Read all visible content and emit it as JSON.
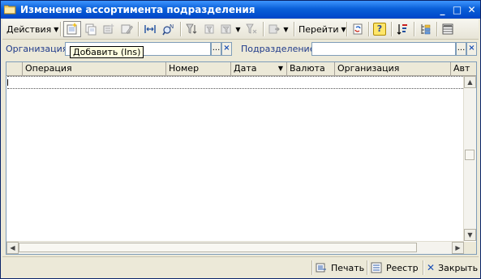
{
  "window": {
    "title": "Изменение ассортимента подразделения",
    "controls": {
      "minimize": "_",
      "maximize": "□",
      "close": "✕"
    }
  },
  "toolbar": {
    "actions_label": "Действия",
    "goto_label": "Перейти",
    "help_label": "?",
    "icons": [
      "add-icon",
      "copy-icon",
      "add-group-icon",
      "edit-icon",
      "swap-icon",
      "find-icon",
      "filter-icon",
      "filter-list-icon",
      "filter-clear-icon",
      "post-icon",
      "refresh-icon",
      "help-icon",
      "sort-icon",
      "hierarchy-icon",
      "list-settings-icon"
    ]
  },
  "tooltip": {
    "text": "Добавить (Ins)"
  },
  "filters": {
    "organization_label": "Организация:",
    "organization_value": "",
    "department_label": "Подразделение:",
    "department_value": "",
    "select_button": "...",
    "clear_button": "×"
  },
  "table": {
    "columns": [
      "Операция",
      "Номер",
      "Дата",
      "Валюта",
      "Организация",
      "Авт"
    ],
    "sort_indicator": "▼",
    "rows": []
  },
  "bottom": {
    "print_label": "Печать",
    "registry_label": "Реестр",
    "close_label": "Закрыть"
  },
  "colors": {
    "title_bar": "#0a5fd8",
    "window_bg": "#ece9d8",
    "label_blue": "#1f3a8a",
    "close_x": "#1a4fb5"
  }
}
